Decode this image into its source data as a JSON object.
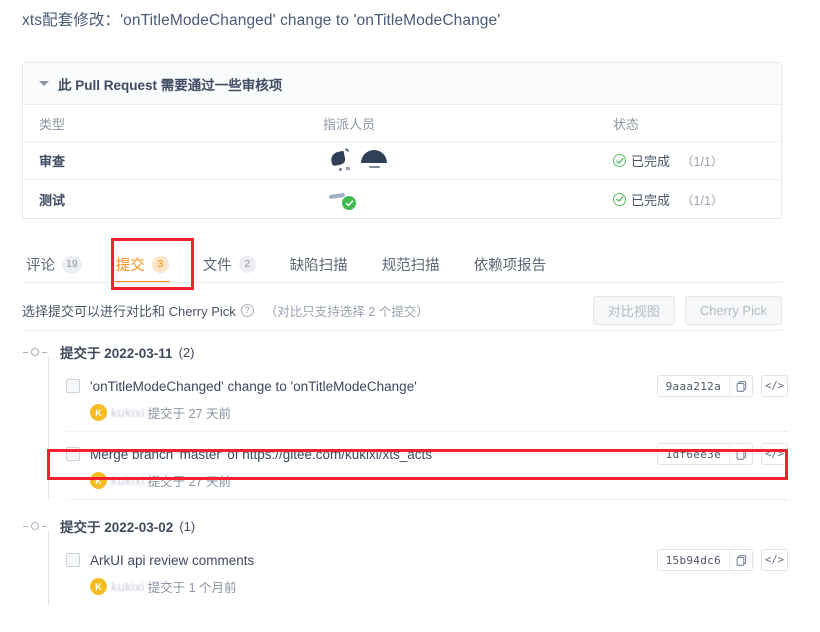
{
  "pr": {
    "title": "xts配套修改：'onTitleModeChanged' change to 'onTitleModeChange'"
  },
  "check_panel": {
    "header": "此 Pull Request 需要通过一些审核项",
    "caret_icon": "caret-down-icon",
    "columns": [
      "类型",
      "指派人员",
      "状态"
    ],
    "rows": [
      {
        "type": "审查",
        "status": "已完成",
        "fraction": "（1/1）",
        "status_icon": "check-circle-icon"
      },
      {
        "type": "测试",
        "status": "已完成",
        "fraction": "（1/1）",
        "status_icon": "check-circle-icon"
      }
    ]
  },
  "tabs": [
    {
      "label": "评论",
      "count": "19",
      "active": false
    },
    {
      "label": "提交",
      "count": "3",
      "active": true
    },
    {
      "label": "文件",
      "count": "2",
      "active": false
    },
    {
      "label": "缺陷扫描",
      "count": "",
      "active": false
    },
    {
      "label": "规范扫描",
      "count": "",
      "active": false
    },
    {
      "label": "依赖项报告",
      "count": "",
      "active": false
    }
  ],
  "toolbar": {
    "hint": "选择提交可以进行对比和 Cherry Pick",
    "help_icon": "question-circle-icon",
    "note": "（对比只支持选择 2 个提交）",
    "compare_button": "对比视图",
    "cherry_pick_button": "Cherry Pick"
  },
  "commit_groups": [
    {
      "date_label": "提交于 2022-03-11",
      "count": "(2)",
      "commits": [
        {
          "message": "'onTitleModeChanged' change to 'onTitleModeChange'",
          "hash": "9aaa212a",
          "author_initial": "K",
          "author": "kukixi",
          "meta": "提交于 27 天前",
          "highlighted": false
        },
        {
          "message": "Merge branch 'master' of https://gitee.com/kukixi/xts_acts",
          "hash": "1df6ee3e",
          "author_initial": "K",
          "author": "kukixi",
          "meta": "提交于 27 天前",
          "highlighted": true
        }
      ]
    },
    {
      "date_label": "提交于 2022-03-02",
      "count": "(1)",
      "commits": [
        {
          "message": "ArkUI api review comments",
          "hash": "15b94dc6",
          "author_initial": "K",
          "author": "kukixi",
          "meta": "提交于 1 个月前",
          "highlighted": false
        }
      ]
    }
  ],
  "icons": {
    "copy": "copy-icon",
    "code": "code-brackets-icon",
    "checkbox": "checkbox-unchecked-icon",
    "timeline_node": "timeline-node-icon"
  },
  "colors": {
    "accent": "#fa8c16",
    "annotation": "#f5222d",
    "success": "#5bbd6a",
    "avatar": "#f5bd23",
    "text": "#3c4760"
  },
  "annotations": [
    {
      "name": "tab-highlight",
      "target": "提交"
    },
    {
      "name": "commit-row-highlight",
      "target": "Merge branch 'master' of https://gitee.com/kukixi/xts_acts"
    }
  ]
}
